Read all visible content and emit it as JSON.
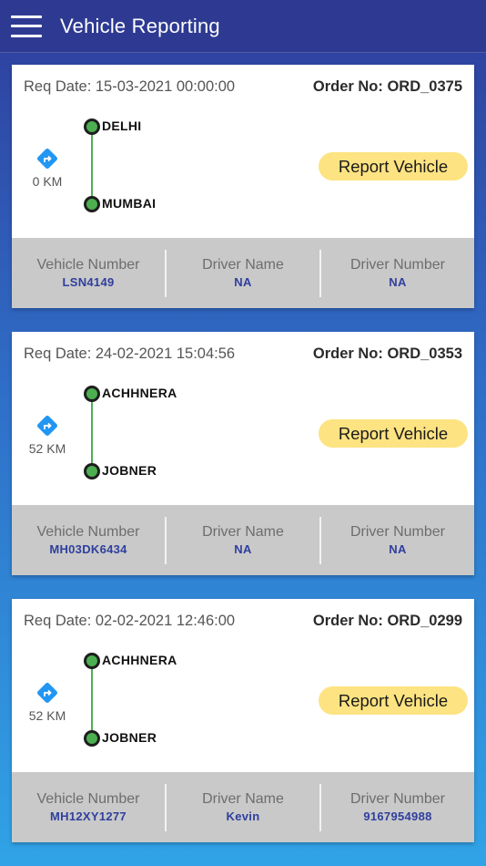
{
  "appbar": {
    "title": "Vehicle Reporting",
    "menu_icon": "hamburger-menu-icon"
  },
  "colors": {
    "appbar": "#2e3a92",
    "route": "#4caf50",
    "report_button": "#fde381",
    "value_text": "#2f3f9e",
    "direction_icon": "#2196f3"
  },
  "orders": [
    {
      "req_date": "Req Date: 15-03-2021 00:00:00",
      "order_no": "Order No: ORD_0375",
      "distance": "0 KM",
      "from": "DELHI",
      "to": "MUMBAI",
      "report_label": "Report Vehicle",
      "vehicle_number_label": "Vehicle Number",
      "vehicle_number": "LSN4149",
      "driver_name_label": "Driver Name",
      "driver_name": "NA",
      "driver_number_label": "Driver Number",
      "driver_number": "NA"
    },
    {
      "req_date": "Req Date: 24-02-2021 15:04:56",
      "order_no": "Order No: ORD_0353",
      "distance": "52 KM",
      "from": "ACHHNERA",
      "to": "JOBNER",
      "report_label": "Report Vehicle",
      "vehicle_number_label": "Vehicle Number",
      "vehicle_number": "MH03DK6434",
      "driver_name_label": "Driver Name",
      "driver_name": "NA",
      "driver_number_label": "Driver Number",
      "driver_number": "NA"
    },
    {
      "req_date": "Req Date: 02-02-2021 12:46:00",
      "order_no": "Order No: ORD_0299",
      "distance": "52 KM",
      "from": "ACHHNERA",
      "to": "JOBNER",
      "report_label": "Report Vehicle",
      "vehicle_number_label": "Vehicle Number",
      "vehicle_number": "MH12XY1277",
      "driver_name_label": "Driver Name",
      "driver_name": "Kevin",
      "driver_number_label": "Driver Number",
      "driver_number": "9167954988"
    }
  ]
}
